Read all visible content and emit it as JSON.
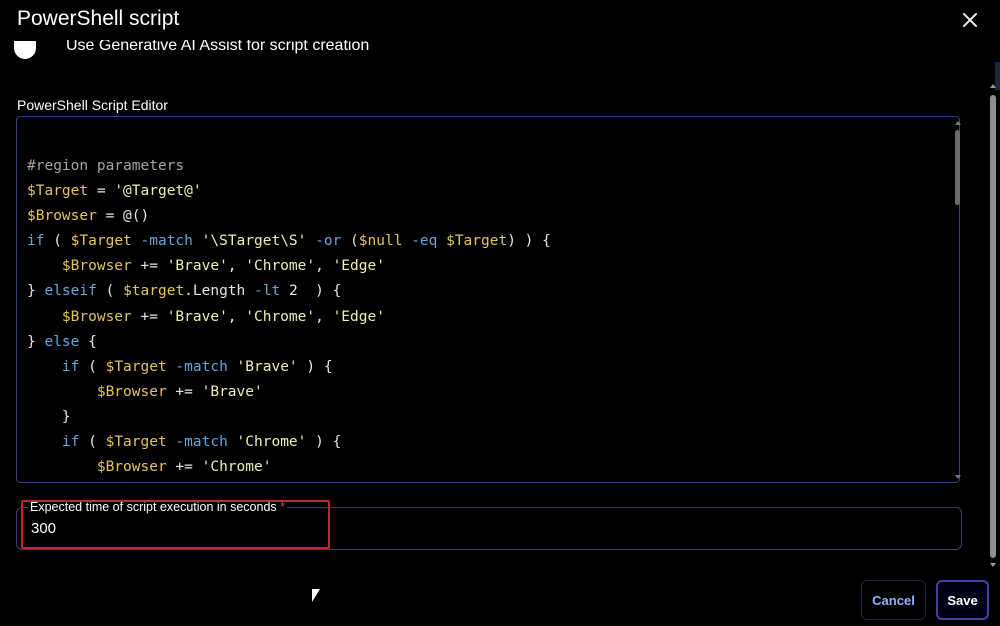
{
  "dialog": {
    "title": "PowerShell script",
    "close_icon": "close-icon"
  },
  "toggle": {
    "label": "Use Generative AI Assist for script creation"
  },
  "editor": {
    "label": "PowerShell Script Editor",
    "lines": [
      [
        {
          "t": "comment",
          "v": "#region parameters"
        }
      ],
      [
        {
          "t": "var",
          "v": "$Target"
        },
        {
          "t": "plain",
          "v": " = "
        },
        {
          "t": "str",
          "v": "'@Target@'"
        }
      ],
      [
        {
          "t": "var",
          "v": "$Browser"
        },
        {
          "t": "plain",
          "v": " = @()"
        }
      ],
      [
        {
          "t": "kw",
          "v": "if"
        },
        {
          "t": "plain",
          "v": " ( "
        },
        {
          "t": "var",
          "v": "$Target"
        },
        {
          "t": "op",
          "v": " -match "
        },
        {
          "t": "str",
          "v": "'\\STarget\\S'"
        },
        {
          "t": "op",
          "v": " -or "
        },
        {
          "t": "plain",
          "v": "("
        },
        {
          "t": "var",
          "v": "$null"
        },
        {
          "t": "op",
          "v": " -eq "
        },
        {
          "t": "var",
          "v": "$Target"
        },
        {
          "t": "plain",
          "v": ") ) {"
        }
      ],
      [
        {
          "t": "plain",
          "v": "    "
        },
        {
          "t": "var",
          "v": "$Browser"
        },
        {
          "t": "plain",
          "v": " += "
        },
        {
          "t": "str",
          "v": "'Brave'"
        },
        {
          "t": "plain",
          "v": ", "
        },
        {
          "t": "str",
          "v": "'Chrome'"
        },
        {
          "t": "plain",
          "v": ", "
        },
        {
          "t": "str",
          "v": "'Edge'"
        }
      ],
      [
        {
          "t": "plain",
          "v": "} "
        },
        {
          "t": "kw",
          "v": "elseif"
        },
        {
          "t": "plain",
          "v": " ( "
        },
        {
          "t": "var",
          "v": "$target"
        },
        {
          "t": "plain",
          "v": ".Length"
        },
        {
          "t": "op",
          "v": " -lt "
        },
        {
          "t": "plain",
          "v": "2  ) {"
        }
      ],
      [
        {
          "t": "plain",
          "v": "    "
        },
        {
          "t": "var",
          "v": "$Browser"
        },
        {
          "t": "plain",
          "v": " += "
        },
        {
          "t": "str",
          "v": "'Brave'"
        },
        {
          "t": "plain",
          "v": ", "
        },
        {
          "t": "str",
          "v": "'Chrome'"
        },
        {
          "t": "plain",
          "v": ", "
        },
        {
          "t": "str",
          "v": "'Edge'"
        }
      ],
      [
        {
          "t": "plain",
          "v": "} "
        },
        {
          "t": "kw",
          "v": "else"
        },
        {
          "t": "plain",
          "v": " {"
        }
      ],
      [
        {
          "t": "plain",
          "v": "    "
        },
        {
          "t": "kw",
          "v": "if"
        },
        {
          "t": "plain",
          "v": " ( "
        },
        {
          "t": "var",
          "v": "$Target"
        },
        {
          "t": "op",
          "v": " -match "
        },
        {
          "t": "str",
          "v": "'Brave'"
        },
        {
          "t": "plain",
          "v": " ) {"
        }
      ],
      [
        {
          "t": "plain",
          "v": "        "
        },
        {
          "t": "var",
          "v": "$Browser"
        },
        {
          "t": "plain",
          "v": " += "
        },
        {
          "t": "str",
          "v": "'Brave'"
        }
      ],
      [
        {
          "t": "plain",
          "v": "    }"
        }
      ],
      [
        {
          "t": "plain",
          "v": "    "
        },
        {
          "t": "kw",
          "v": "if"
        },
        {
          "t": "plain",
          "v": " ( "
        },
        {
          "t": "var",
          "v": "$Target"
        },
        {
          "t": "op",
          "v": " -match "
        },
        {
          "t": "str",
          "v": "'Chrome'"
        },
        {
          "t": "plain",
          "v": " ) {"
        }
      ],
      [
        {
          "t": "plain",
          "v": "        "
        },
        {
          "t": "var",
          "v": "$Browser"
        },
        {
          "t": "plain",
          "v": " += "
        },
        {
          "t": "str",
          "v": "'Chrome'"
        }
      ]
    ]
  },
  "execution_time": {
    "label": "Expected time of script execution in seconds",
    "required_mark": "*",
    "value": "300"
  },
  "actions": {
    "cancel_label": "Cancel",
    "save_label": "Save"
  },
  "colors": {
    "background": "#000000",
    "variable": "#e5c45b",
    "string": "#f1eeb0",
    "keyword": "#5ea8e0",
    "comment": "#a5a5a5",
    "required": "#e24a4a",
    "highlight": "#c0272d",
    "cancel_text": "#8fb3ff",
    "save_border": "#4a3f9a"
  }
}
